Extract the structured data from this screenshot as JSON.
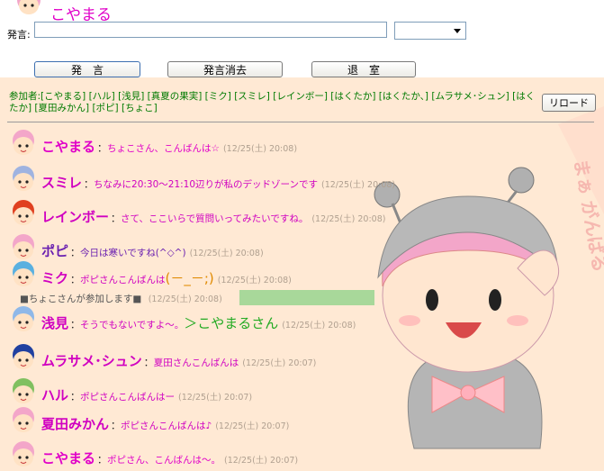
{
  "header": {
    "user_name": "こやまる",
    "say_label": "発言:",
    "input_value": "",
    "color_select_value": ""
  },
  "buttons": {
    "say": "発　言",
    "clear": "発言消去",
    "exit": "退　室",
    "reload": "リロード"
  },
  "participants_text": "参加者:[こやまる] [ハル] [浅見] [真夏の果実] [ミク] [スミレ] [レインボー] [はくたか] [はくたか、] [ムラサメ･シュン] [はくたか] [夏田みかん] [ポピ] [ちょこ]",
  "messages": [
    {
      "speaker": "こやまる",
      "text": "ちょこさん、こんばんは☆",
      "time": "(12/25(土) 20:08)",
      "color": "#e000c8",
      "hair": "#f3a6c9"
    },
    {
      "speaker": "スミレ",
      "text": "ちなみに20:30～21:10辺りが私のデッドゾーンです",
      "time": "(12/25(土) 20:08)",
      "color": "#d000c0",
      "hair": "#9fb3e0"
    },
    {
      "speaker": "レインボー",
      "text": "さて、ここいらで質問いってみたいですね。",
      "time": "(12/25(土) 20:08)",
      "color": "#d000c0",
      "hair": "#e04020"
    },
    {
      "speaker": "ポピ",
      "text": "今日は寒いですね(^◇^)",
      "time": "(12/25(土) 20:08)",
      "color": "#6a20b0",
      "hair": "#f3a6c9"
    },
    {
      "speaker": "ミク",
      "text": "ポピさんこんばんは",
      "extra": "(－_－;)",
      "extra_color": "#e08a00",
      "time": "(12/25(土) 20:08)",
      "color": "#d000c0",
      "hair": "#5ab0e0"
    },
    {
      "speaker": "浅見",
      "text": "そうでもないですよ～。",
      "extra": "＞こやまるさん",
      "extra_color": "#22aa22",
      "time": "(12/25(土) 20:08)",
      "color": "#d000c0",
      "hair": "#8fb8e8"
    },
    {
      "speaker": "ムラサメ･シュン",
      "text": "夏田さんこんばんは",
      "time": "(12/25(土) 20:07)",
      "color": "#d000c0",
      "hair": "#2040a0"
    },
    {
      "speaker": "ハル",
      "text": "ポピさんこんばんはー",
      "time": "(12/25(土) 20:07)",
      "color": "#d000c0",
      "hair": "#80c060"
    },
    {
      "speaker": "夏田みかん",
      "text": "ポピさんこんばんは♪",
      "time": "(12/25(土) 20:07)",
      "color": "#d000c0",
      "hair": "#f3a6c9"
    },
    {
      "speaker": "こやまる",
      "text": "ポピさん、こんばんは～。",
      "time": "(12/25(土) 20:07)",
      "color": "#e000c8",
      "hair": "#f3a6c9"
    }
  ],
  "system_message": {
    "text": "■ちょこさんが参加します■",
    "time": "(12/25(土) 20:08)"
  },
  "decoration_text": "まぁ がんばる",
  "colors": {
    "background": "#ffe9d4",
    "speaker": "#e000c8",
    "participants": "#007a00"
  }
}
